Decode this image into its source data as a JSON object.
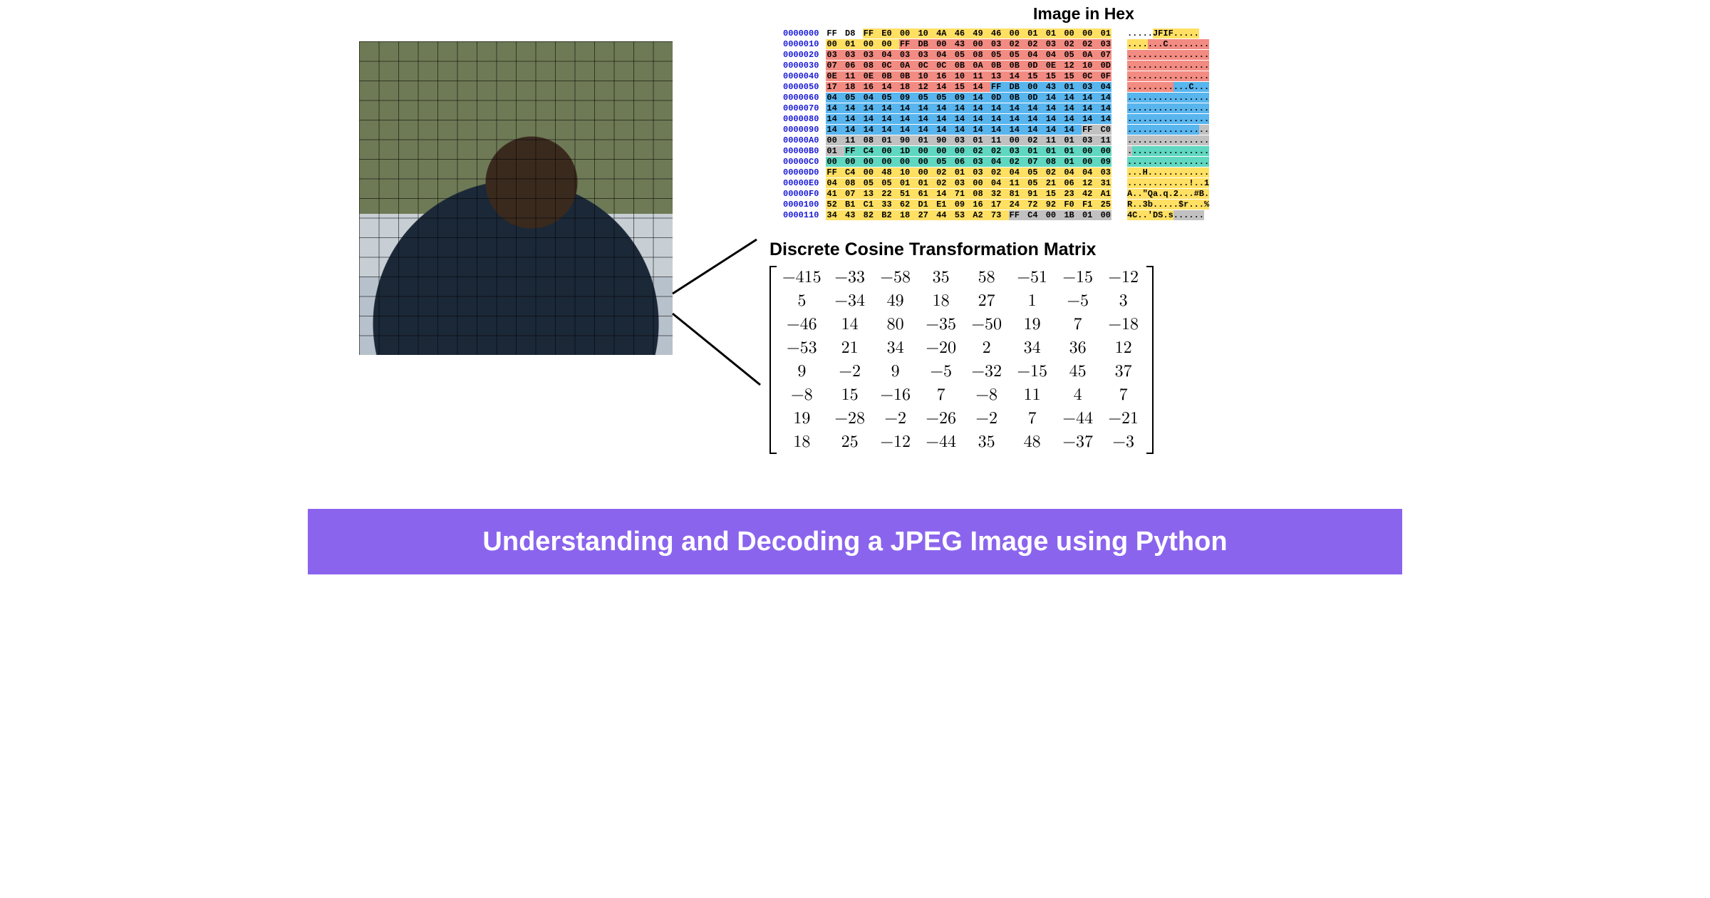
{
  "hex": {
    "title": "Image in Hex",
    "addresses": [
      "0000000",
      "0000010",
      "0000020",
      "0000030",
      "0000040",
      "0000050",
      "0000060",
      "0000070",
      "0000080",
      "0000090",
      "00000A0",
      "00000B0",
      "00000C0",
      "00000D0",
      "00000E0",
      "00000F0",
      "0000100",
      "0000110"
    ],
    "rows": [
      [
        [
          "FF",
          "none"
        ],
        [
          "D8",
          "none"
        ],
        [
          "FF",
          "y"
        ],
        [
          "E0",
          "y"
        ],
        [
          "00",
          "y"
        ],
        [
          "10",
          "y"
        ],
        [
          "4A",
          "y"
        ],
        [
          "46",
          "y"
        ],
        [
          "49",
          "y"
        ],
        [
          "46",
          "y"
        ],
        [
          "00",
          "y"
        ],
        [
          "01",
          "y"
        ],
        [
          "01",
          "y"
        ],
        [
          "00",
          "y"
        ],
        [
          "00",
          "y"
        ],
        [
          "01",
          "y"
        ]
      ],
      [
        [
          "00",
          "y"
        ],
        [
          "01",
          "y"
        ],
        [
          "00",
          "y"
        ],
        [
          "00",
          "y"
        ],
        [
          "FF",
          "r"
        ],
        [
          "DB",
          "r"
        ],
        [
          "00",
          "r"
        ],
        [
          "43",
          "r"
        ],
        [
          "00",
          "r"
        ],
        [
          "03",
          "r"
        ],
        [
          "02",
          "r"
        ],
        [
          "02",
          "r"
        ],
        [
          "03",
          "r"
        ],
        [
          "02",
          "r"
        ],
        [
          "02",
          "r"
        ],
        [
          "03",
          "r"
        ]
      ],
      [
        [
          "03",
          "r"
        ],
        [
          "03",
          "r"
        ],
        [
          "03",
          "r"
        ],
        [
          "04",
          "r"
        ],
        [
          "03",
          "r"
        ],
        [
          "03",
          "r"
        ],
        [
          "04",
          "r"
        ],
        [
          "05",
          "r"
        ],
        [
          "08",
          "r"
        ],
        [
          "05",
          "r"
        ],
        [
          "05",
          "r"
        ],
        [
          "04",
          "r"
        ],
        [
          "04",
          "r"
        ],
        [
          "05",
          "r"
        ],
        [
          "0A",
          "r"
        ],
        [
          "07",
          "r"
        ]
      ],
      [
        [
          "07",
          "r"
        ],
        [
          "06",
          "r"
        ],
        [
          "08",
          "r"
        ],
        [
          "0C",
          "r"
        ],
        [
          "0A",
          "r"
        ],
        [
          "0C",
          "r"
        ],
        [
          "0C",
          "r"
        ],
        [
          "0B",
          "r"
        ],
        [
          "0A",
          "r"
        ],
        [
          "0B",
          "r"
        ],
        [
          "0B",
          "r"
        ],
        [
          "0D",
          "r"
        ],
        [
          "0E",
          "r"
        ],
        [
          "12",
          "r"
        ],
        [
          "10",
          "r"
        ],
        [
          "0D",
          "r"
        ]
      ],
      [
        [
          "0E",
          "r"
        ],
        [
          "11",
          "r"
        ],
        [
          "0E",
          "r"
        ],
        [
          "0B",
          "r"
        ],
        [
          "0B",
          "r"
        ],
        [
          "10",
          "r"
        ],
        [
          "16",
          "r"
        ],
        [
          "10",
          "r"
        ],
        [
          "11",
          "r"
        ],
        [
          "13",
          "r"
        ],
        [
          "14",
          "r"
        ],
        [
          "15",
          "r"
        ],
        [
          "15",
          "r"
        ],
        [
          "15",
          "r"
        ],
        [
          "0C",
          "r"
        ],
        [
          "0F",
          "r"
        ]
      ],
      [
        [
          "17",
          "r"
        ],
        [
          "18",
          "r"
        ],
        [
          "16",
          "r"
        ],
        [
          "14",
          "r"
        ],
        [
          "18",
          "r"
        ],
        [
          "12",
          "r"
        ],
        [
          "14",
          "r"
        ],
        [
          "15",
          "r"
        ],
        [
          "14",
          "r"
        ],
        [
          "FF",
          "b"
        ],
        [
          "DB",
          "b"
        ],
        [
          "00",
          "b"
        ],
        [
          "43",
          "b"
        ],
        [
          "01",
          "b"
        ],
        [
          "03",
          "b"
        ],
        [
          "04",
          "b"
        ]
      ],
      [
        [
          "04",
          "b"
        ],
        [
          "05",
          "b"
        ],
        [
          "04",
          "b"
        ],
        [
          "05",
          "b"
        ],
        [
          "09",
          "b"
        ],
        [
          "05",
          "b"
        ],
        [
          "05",
          "b"
        ],
        [
          "09",
          "b"
        ],
        [
          "14",
          "b"
        ],
        [
          "0D",
          "b"
        ],
        [
          "0B",
          "b"
        ],
        [
          "0D",
          "b"
        ],
        [
          "14",
          "b"
        ],
        [
          "14",
          "b"
        ],
        [
          "14",
          "b"
        ],
        [
          "14",
          "b"
        ]
      ],
      [
        [
          "14",
          "b"
        ],
        [
          "14",
          "b"
        ],
        [
          "14",
          "b"
        ],
        [
          "14",
          "b"
        ],
        [
          "14",
          "b"
        ],
        [
          "14",
          "b"
        ],
        [
          "14",
          "b"
        ],
        [
          "14",
          "b"
        ],
        [
          "14",
          "b"
        ],
        [
          "14",
          "b"
        ],
        [
          "14",
          "b"
        ],
        [
          "14",
          "b"
        ],
        [
          "14",
          "b"
        ],
        [
          "14",
          "b"
        ],
        [
          "14",
          "b"
        ],
        [
          "14",
          "b"
        ]
      ],
      [
        [
          "14",
          "b"
        ],
        [
          "14",
          "b"
        ],
        [
          "14",
          "b"
        ],
        [
          "14",
          "b"
        ],
        [
          "14",
          "b"
        ],
        [
          "14",
          "b"
        ],
        [
          "14",
          "b"
        ],
        [
          "14",
          "b"
        ],
        [
          "14",
          "b"
        ],
        [
          "14",
          "b"
        ],
        [
          "14",
          "b"
        ],
        [
          "14",
          "b"
        ],
        [
          "14",
          "b"
        ],
        [
          "14",
          "b"
        ],
        [
          "14",
          "b"
        ],
        [
          "14",
          "b"
        ]
      ],
      [
        [
          "14",
          "b"
        ],
        [
          "14",
          "b"
        ],
        [
          "14",
          "b"
        ],
        [
          "14",
          "b"
        ],
        [
          "14",
          "b"
        ],
        [
          "14",
          "b"
        ],
        [
          "14",
          "b"
        ],
        [
          "14",
          "b"
        ],
        [
          "14",
          "b"
        ],
        [
          "14",
          "b"
        ],
        [
          "14",
          "b"
        ],
        [
          "14",
          "b"
        ],
        [
          "14",
          "b"
        ],
        [
          "14",
          "b"
        ],
        [
          "FF",
          "g"
        ],
        [
          "C0",
          "g"
        ]
      ],
      [
        [
          "00",
          "g"
        ],
        [
          "11",
          "g"
        ],
        [
          "08",
          "g"
        ],
        [
          "01",
          "g"
        ],
        [
          "90",
          "g"
        ],
        [
          "01",
          "g"
        ],
        [
          "90",
          "g"
        ],
        [
          "03",
          "g"
        ],
        [
          "01",
          "g"
        ],
        [
          "11",
          "g"
        ],
        [
          "00",
          "g"
        ],
        [
          "02",
          "g"
        ],
        [
          "11",
          "g"
        ],
        [
          "01",
          "g"
        ],
        [
          "03",
          "g"
        ],
        [
          "11",
          "g"
        ]
      ],
      [
        [
          "01",
          "g"
        ],
        [
          "FF",
          "t"
        ],
        [
          "C4",
          "t"
        ],
        [
          "00",
          "t"
        ],
        [
          "1D",
          "t"
        ],
        [
          "00",
          "t"
        ],
        [
          "00",
          "t"
        ],
        [
          "00",
          "t"
        ],
        [
          "02",
          "t"
        ],
        [
          "02",
          "t"
        ],
        [
          "03",
          "t"
        ],
        [
          "01",
          "t"
        ],
        [
          "01",
          "t"
        ],
        [
          "01",
          "t"
        ],
        [
          "00",
          "t"
        ],
        [
          "00",
          "t"
        ]
      ],
      [
        [
          "00",
          "t"
        ],
        [
          "00",
          "t"
        ],
        [
          "00",
          "t"
        ],
        [
          "00",
          "t"
        ],
        [
          "00",
          "t"
        ],
        [
          "00",
          "t"
        ],
        [
          "05",
          "t"
        ],
        [
          "06",
          "t"
        ],
        [
          "03",
          "t"
        ],
        [
          "04",
          "t"
        ],
        [
          "02",
          "t"
        ],
        [
          "07",
          "t"
        ],
        [
          "08",
          "t"
        ],
        [
          "01",
          "t"
        ],
        [
          "00",
          "t"
        ],
        [
          "09",
          "t"
        ]
      ],
      [
        [
          "FF",
          "y"
        ],
        [
          "C4",
          "y"
        ],
        [
          "00",
          "y"
        ],
        [
          "48",
          "y"
        ],
        [
          "10",
          "y"
        ],
        [
          "00",
          "y"
        ],
        [
          "02",
          "y"
        ],
        [
          "01",
          "y"
        ],
        [
          "03",
          "y"
        ],
        [
          "02",
          "y"
        ],
        [
          "04",
          "y"
        ],
        [
          "05",
          "y"
        ],
        [
          "02",
          "y"
        ],
        [
          "04",
          "y"
        ],
        [
          "04",
          "y"
        ],
        [
          "03",
          "y"
        ]
      ],
      [
        [
          "04",
          "y"
        ],
        [
          "08",
          "y"
        ],
        [
          "05",
          "y"
        ],
        [
          "05",
          "y"
        ],
        [
          "01",
          "y"
        ],
        [
          "01",
          "y"
        ],
        [
          "02",
          "y"
        ],
        [
          "03",
          "y"
        ],
        [
          "00",
          "y"
        ],
        [
          "04",
          "y"
        ],
        [
          "11",
          "y"
        ],
        [
          "05",
          "y"
        ],
        [
          "21",
          "y"
        ],
        [
          "06",
          "y"
        ],
        [
          "12",
          "y"
        ],
        [
          "31",
          "y"
        ]
      ],
      [
        [
          "41",
          "y"
        ],
        [
          "07",
          "y"
        ],
        [
          "13",
          "y"
        ],
        [
          "22",
          "y"
        ],
        [
          "51",
          "y"
        ],
        [
          "61",
          "y"
        ],
        [
          "14",
          "y"
        ],
        [
          "71",
          "y"
        ],
        [
          "08",
          "y"
        ],
        [
          "32",
          "y"
        ],
        [
          "81",
          "y"
        ],
        [
          "91",
          "y"
        ],
        [
          "15",
          "y"
        ],
        [
          "23",
          "y"
        ],
        [
          "42",
          "y"
        ],
        [
          "A1",
          "y"
        ]
      ],
      [
        [
          "52",
          "y"
        ],
        [
          "B1",
          "y"
        ],
        [
          "C1",
          "y"
        ],
        [
          "33",
          "y"
        ],
        [
          "62",
          "y"
        ],
        [
          "D1",
          "y"
        ],
        [
          "E1",
          "y"
        ],
        [
          "09",
          "y"
        ],
        [
          "16",
          "y"
        ],
        [
          "17",
          "y"
        ],
        [
          "24",
          "y"
        ],
        [
          "72",
          "y"
        ],
        [
          "92",
          "y"
        ],
        [
          "F0",
          "y"
        ],
        [
          "F1",
          "y"
        ],
        [
          "25",
          "y"
        ]
      ],
      [
        [
          "34",
          "y"
        ],
        [
          "43",
          "y"
        ],
        [
          "82",
          "y"
        ],
        [
          "B2",
          "y"
        ],
        [
          "18",
          "y"
        ],
        [
          "27",
          "y"
        ],
        [
          "44",
          "y"
        ],
        [
          "53",
          "y"
        ],
        [
          "A2",
          "y"
        ],
        [
          "73",
          "y"
        ],
        [
          "FF",
          "g"
        ],
        [
          "C4",
          "g"
        ],
        [
          "00",
          "g"
        ],
        [
          "1B",
          "g"
        ],
        [
          "01",
          "g"
        ],
        [
          "00",
          "g"
        ]
      ]
    ],
    "ascii": [
      [
        [
          ".....",
          "none"
        ],
        [
          "JFIF.....",
          "y"
        ]
      ],
      [
        [
          "....",
          "y"
        ],
        [
          "...C........",
          "r"
        ]
      ],
      [
        [
          "................",
          "r"
        ]
      ],
      [
        [
          "................",
          "r"
        ]
      ],
      [
        [
          "................",
          "r"
        ]
      ],
      [
        [
          ".........",
          "r"
        ],
        [
          "...C...",
          "b"
        ]
      ],
      [
        [
          "................",
          "b"
        ]
      ],
      [
        [
          "................",
          "b"
        ]
      ],
      [
        [
          "................",
          "b"
        ]
      ],
      [
        [
          "..............",
          "b"
        ],
        [
          "..",
          "g"
        ]
      ],
      [
        [
          "................",
          "g"
        ]
      ],
      [
        [
          ".",
          "g"
        ],
        [
          "...............",
          "t"
        ]
      ],
      [
        [
          "................",
          "t"
        ]
      ],
      [
        [
          "...H............",
          "y"
        ]
      ],
      [
        [
          "............!..1",
          "y"
        ]
      ],
      [
        [
          "A..\"Qa.q.2...#B.",
          "y"
        ]
      ],
      [
        [
          "R..3b.....$r...%",
          "y"
        ]
      ],
      [
        [
          "4C..'DS.s",
          "y"
        ],
        [
          "......",
          "g"
        ]
      ]
    ]
  },
  "dct": {
    "title": "Discrete Cosine Transformation Matrix",
    "matrix": [
      [
        -415,
        -33,
        -58,
        35,
        58,
        -51,
        -15,
        -12
      ],
      [
        5,
        -34,
        49,
        18,
        27,
        1,
        -5,
        3
      ],
      [
        -46,
        14,
        80,
        -35,
        -50,
        19,
        7,
        -18
      ],
      [
        -53,
        21,
        34,
        -20,
        2,
        34,
        36,
        12
      ],
      [
        9,
        -2,
        9,
        -5,
        -32,
        -15,
        45,
        37
      ],
      [
        -8,
        15,
        -16,
        7,
        -8,
        11,
        4,
        7
      ],
      [
        19,
        -28,
        -2,
        -26,
        -2,
        7,
        -44,
        -21
      ],
      [
        18,
        25,
        -12,
        -44,
        35,
        48,
        -37,
        -3
      ]
    ]
  },
  "footer": {
    "text": "Understanding and Decoding a JPEG Image using Python"
  },
  "chart_data": {
    "type": "table",
    "title": "Discrete Cosine Transformation Matrix",
    "matrix": [
      [
        -415,
        -33,
        -58,
        35,
        58,
        -51,
        -15,
        -12
      ],
      [
        5,
        -34,
        49,
        18,
        27,
        1,
        -5,
        3
      ],
      [
        -46,
        14,
        80,
        -35,
        -50,
        19,
        7,
        -18
      ],
      [
        -53,
        21,
        34,
        -20,
        2,
        34,
        36,
        12
      ],
      [
        9,
        -2,
        9,
        -5,
        -32,
        -15,
        45,
        37
      ],
      [
        -8,
        15,
        -16,
        7,
        -8,
        11,
        4,
        7
      ],
      [
        19,
        -28,
        -2,
        -26,
        -2,
        7,
        -44,
        -21
      ],
      [
        18,
        25,
        -12,
        -44,
        35,
        48,
        -37,
        -3
      ]
    ]
  }
}
